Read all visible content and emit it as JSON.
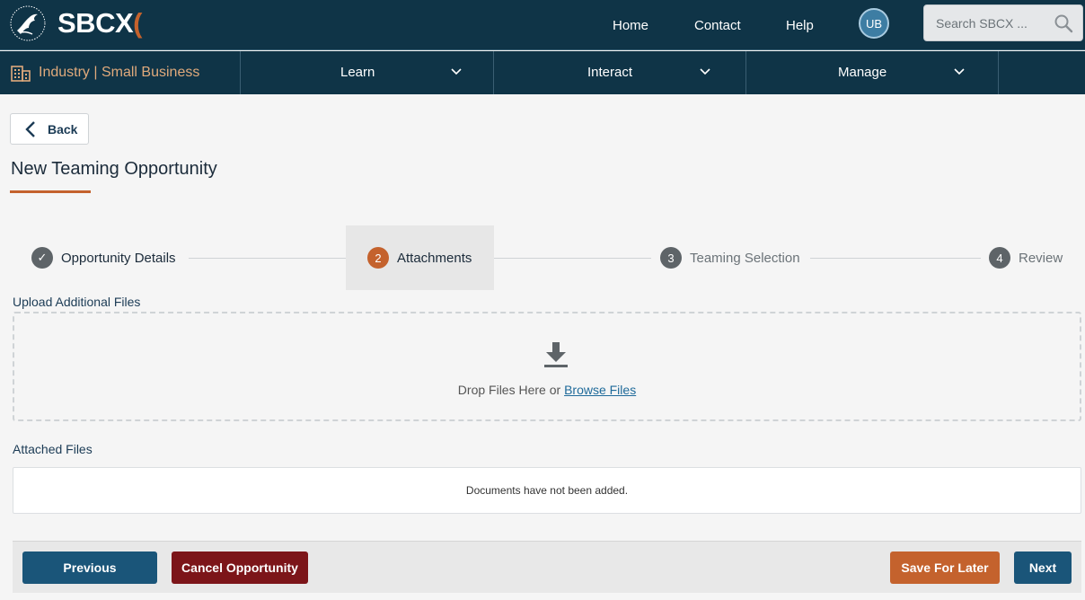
{
  "header": {
    "logo_text_main": "SBCX",
    "logo_text_accent": "(",
    "nav": [
      "Home",
      "Contact",
      "Help"
    ],
    "avatar_initials": "UB",
    "search_placeholder": "Search SBCX ..."
  },
  "secondary_nav": {
    "brand_label": "Industry | Small Business",
    "items": [
      "Learn",
      "Interact",
      "Manage"
    ]
  },
  "page": {
    "back_label": "Back",
    "title": "New Teaming Opportunity"
  },
  "stepper": {
    "steps": [
      {
        "number": "✓",
        "label": "Opportunity Details",
        "state": "complete"
      },
      {
        "number": "2",
        "label": "Attachments",
        "state": "active"
      },
      {
        "number": "3",
        "label": "Teaming Selection",
        "state": "pending"
      },
      {
        "number": "4",
        "label": "Review",
        "state": "pending"
      }
    ]
  },
  "upload": {
    "section_label": "Upload Additional Files",
    "drop_text": "Drop Files Here or",
    "browse_label": "Browse Files"
  },
  "attached": {
    "section_label": "Attached Files",
    "empty_message": "Documents have not been added."
  },
  "footer": {
    "previous_label": "Previous",
    "cancel_label": "Cancel Opportunity",
    "save_label": "Save For Later",
    "next_label": "Next"
  },
  "colors": {
    "navy": "#0f3447",
    "accent_orange": "#c4622d",
    "button_blue": "#1a5579",
    "button_red": "#7c1519",
    "step_complete": "#5e6468",
    "step_pending": "#5e6468"
  }
}
